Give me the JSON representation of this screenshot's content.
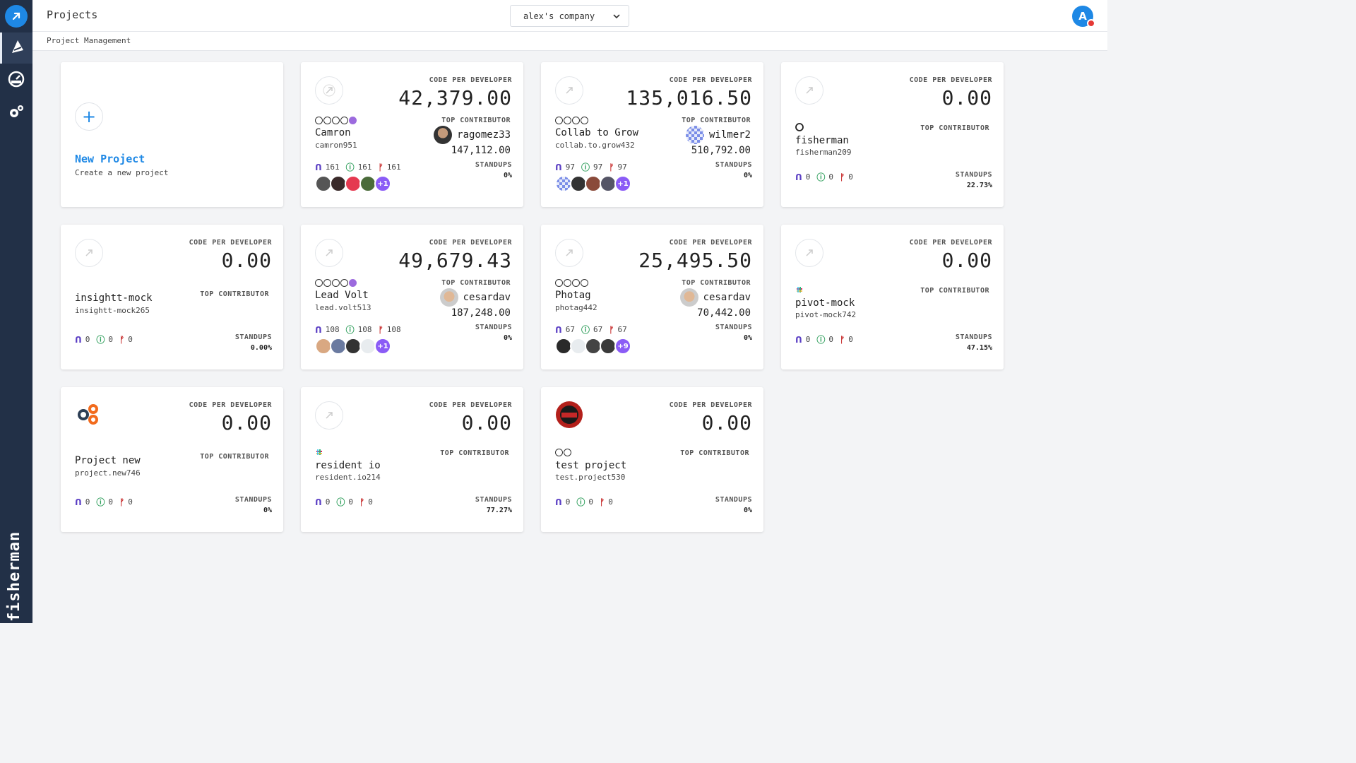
{
  "header": {
    "title": "Projects",
    "company": "alex's company",
    "avatar_letter": "A"
  },
  "breadcrumb": "Project Management",
  "sidebar": {
    "brand": "fisherman",
    "items": [
      "rocket-icon",
      "dashboard-icon",
      "settings-icon"
    ]
  },
  "labels": {
    "code_per_developer": "CODE PER DEVELOPER",
    "top_contributor": "TOP CONTRIBUTOR",
    "standups": "STANDUPS"
  },
  "new_project": {
    "title": "New Project",
    "subtitle": "Create a new project",
    "plus": "+"
  },
  "projects": [
    {
      "name": "Camron",
      "handle": "camron951",
      "cpd": "42,379.00",
      "contributor": "ragomez33",
      "contributor_value": "147,112.00",
      "pr": "161",
      "issues": "161",
      "branches": "161",
      "standups": "0%",
      "more": "+1"
    },
    {
      "name": "Collab to Grow",
      "handle": "collab.to.grow432",
      "cpd": "135,016.50",
      "contributor": "wilmer2",
      "contributor_value": "510,792.00",
      "pr": "97",
      "issues": "97",
      "branches": "97",
      "standups": "0%",
      "more": "+1"
    },
    {
      "name": "fisherman",
      "handle": "fisherman209",
      "cpd": "0.00",
      "pr": "0",
      "issues": "0",
      "branches": "0",
      "standups": "22.73%"
    },
    {
      "name": "insightt-mock",
      "handle": "insightt-mock265",
      "cpd": "0.00",
      "pr": "0",
      "issues": "0",
      "branches": "0",
      "standups": "0.00%"
    },
    {
      "name": "Lead Volt",
      "handle": "lead.volt513",
      "cpd": "49,679.43",
      "contributor": "cesardav",
      "contributor_value": "187,248.00",
      "pr": "108",
      "issues": "108",
      "branches": "108",
      "standups": "0%",
      "more": "+1"
    },
    {
      "name": "Photag",
      "handle": "photag442",
      "cpd": "25,495.50",
      "contributor": "cesardav",
      "contributor_value": "70,442.00",
      "pr": "67",
      "issues": "67",
      "branches": "67",
      "standups": "0%",
      "more": "+9"
    },
    {
      "name": "pivot-mock",
      "handle": "pivot-mock742",
      "cpd": "0.00",
      "pr": "0",
      "issues": "0",
      "branches": "0",
      "standups": "47.15%"
    },
    {
      "name": "Project new",
      "handle": "project.new746",
      "cpd": "0.00",
      "pr": "0",
      "issues": "0",
      "branches": "0",
      "standups": "0%"
    },
    {
      "name": "resident io",
      "handle": "resident.io214",
      "cpd": "0.00",
      "pr": "0",
      "issues": "0",
      "branches": "0",
      "standups": "77.27%"
    },
    {
      "name": "test project",
      "handle": "test.project530",
      "cpd": "0.00",
      "pr": "0",
      "issues": "0",
      "branches": "0",
      "standups": "0%"
    }
  ],
  "colors": {
    "sidebar": "#223047",
    "accent": "#1e88e5",
    "purple": "#8b5cf6"
  }
}
